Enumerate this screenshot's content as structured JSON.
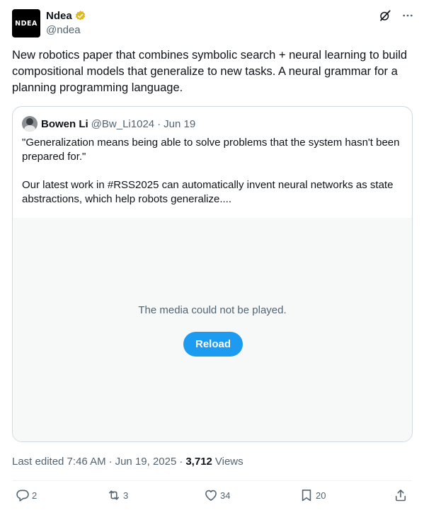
{
  "author": {
    "avatar_text": "NDEA",
    "name": "Ndea",
    "handle": "@ndea"
  },
  "icons": {
    "verified": "verified-badge-gold",
    "grok": "grok-icon",
    "more": "more-icon"
  },
  "tweet": {
    "text": "New robotics paper that combines symbolic search + neural learning to build compositional models that generalize to new tasks. A neural grammar for a planning programming language."
  },
  "quote": {
    "name": "Bowen Li",
    "handle": "@Bw_Li1024",
    "dot": "·",
    "date": "Jun 19",
    "paragraph1": "\"Generalization means being able to solve problems that the system hasn't been prepared for.\"",
    "paragraph2": "Our latest work in #RSS2025 can automatically invent neural networks as state abstractions, which help robots generalize....",
    "media": {
      "message": "The media could not be played.",
      "reload_label": "Reload"
    }
  },
  "meta": {
    "edited": "Last edited 7:46 AM",
    "dot": "·",
    "date": "Jun 19, 2025",
    "views_count": "3,712",
    "views_label": "Views"
  },
  "actions": {
    "replies": "2",
    "reposts": "3",
    "likes": "34",
    "bookmarks": "20"
  },
  "colors": {
    "accent": "#1d9bf0",
    "secondary_text": "#536471",
    "border": "#cfd9de",
    "verified_gold": "#e2b719"
  }
}
